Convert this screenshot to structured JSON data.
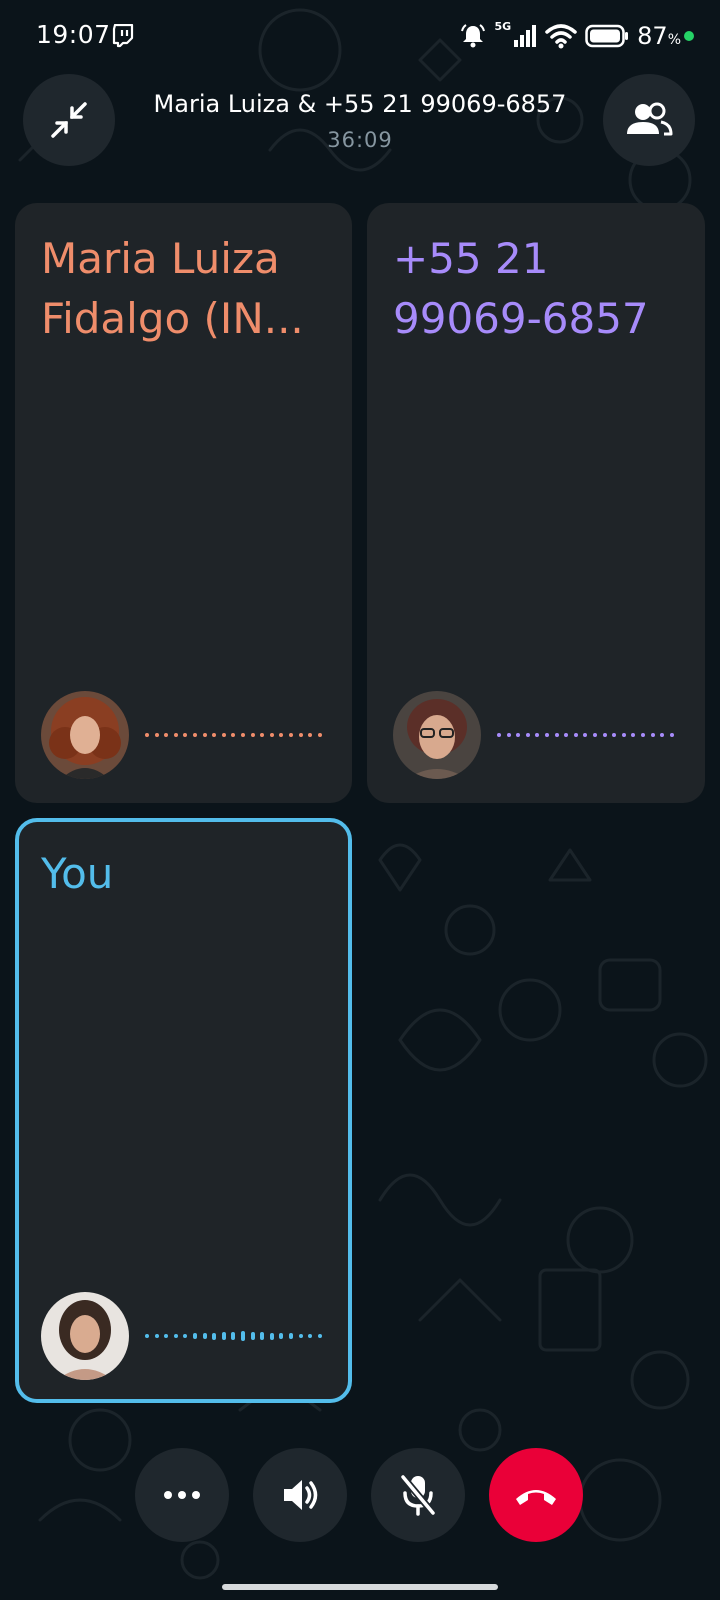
{
  "status_bar": {
    "time": "19:07",
    "network_label": "5G",
    "battery": "87",
    "battery_unit": "%"
  },
  "header": {
    "title": "Maria Luiza & +55 21 99069-6857",
    "timer": "36:09",
    "minimize_icon": "minimize-arrows-icon",
    "participants_icon": "people-icon"
  },
  "tiles": [
    {
      "name_line1": "Maria Luiza",
      "name_line2": "Fidalgo (IN...",
      "color": "#ef8d6b",
      "level": 0.0
    },
    {
      "name_line1": "+55 21",
      "name_line2": "99069-6857",
      "color": "#a78bfa",
      "level": 0.0
    },
    {
      "name_line1": "You",
      "name_line2": "",
      "color": "#53bdeb",
      "border_color": "#53bdeb",
      "level": 0.4
    }
  ],
  "controls": {
    "more_icon": "more-horizontal-icon",
    "speaker_icon": "speaker-icon",
    "mute_icon": "mic-off-icon",
    "end_icon": "end-call-icon",
    "end_color": "#ea0038"
  }
}
